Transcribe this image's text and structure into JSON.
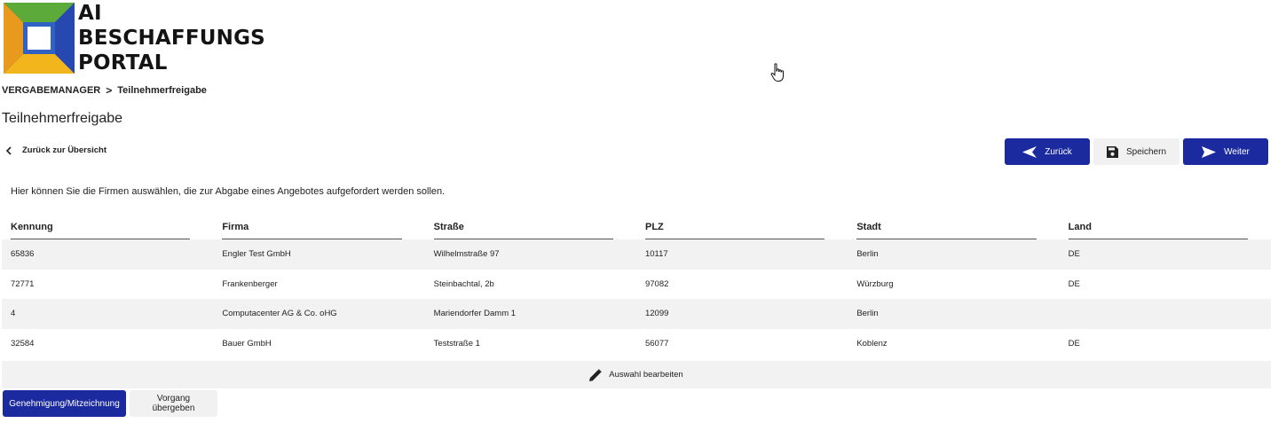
{
  "logo": {
    "line1": "AI",
    "line2": "BESCHAFFUNGS",
    "line3": "PORTAL"
  },
  "breadcrumb": {
    "root": "VERGABEMANAGER",
    "separator": ">",
    "current": "Teilnehmerfreigabe"
  },
  "page_title": "Teilnehmerfreigabe",
  "back_link": "Zurück zur Übersicht",
  "buttons": {
    "back": "Zurück",
    "save": "Speichern",
    "next": "Weiter"
  },
  "intro": "Hier können Sie die Firmen auswählen, die zur Abgabe eines Angebotes aufgefordert werden sollen.",
  "table": {
    "columns": [
      "Kennung",
      "Firma",
      "Straße",
      "PLZ",
      "Stadt",
      "Land"
    ],
    "rows": [
      [
        "65836",
        "Engler Test GmbH",
        "Wilhelmstraße 97",
        "10117",
        "Berlin",
        "DE"
      ],
      [
        "72771",
        "Frankenberger",
        "Steinbachtal, 2b",
        "97082",
        "Würzburg",
        "DE"
      ],
      [
        "4",
        "Computacenter AG & Co. oHG",
        "Mariendorfer Damm 1",
        "12099",
        "Berlin",
        ""
      ],
      [
        "32584",
        "Bauer GmbH",
        "Teststraße 1",
        "56077",
        "Koblenz",
        "DE"
      ]
    ]
  },
  "edit_selection": "Auswahl bearbeiten",
  "bottom_buttons": {
    "approval": "Genehmigung/Mitzeichnung",
    "handover": "Vorgang übergeben"
  },
  "icons": [
    "chevron-left-icon",
    "arrow-left-icon",
    "floppy-disk-icon",
    "send-icon",
    "pencil-icon",
    "hand-cursor-icon"
  ],
  "colors": {
    "primary": "#1b2a9e",
    "light_button": "#f1f1f1",
    "row_alt": "#f2f2f2"
  }
}
